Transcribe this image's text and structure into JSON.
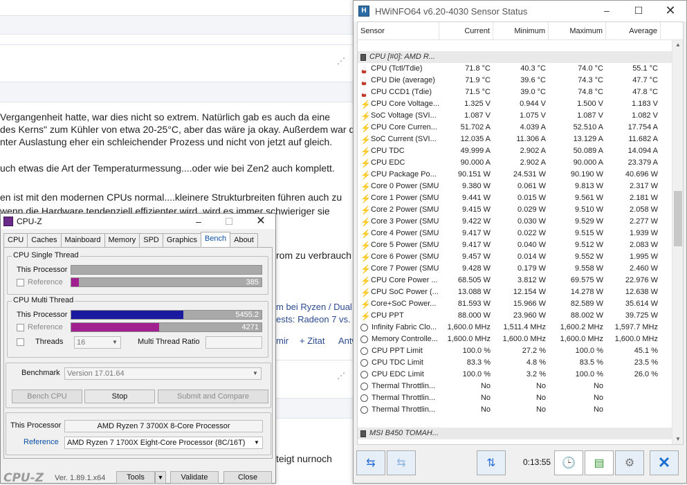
{
  "forum": {
    "top_actions": [
      "Zitat"
    ],
    "p1_line1": "Vergangenheit hatte, war dies nicht so extrem. Natürlich gab es auch da eine",
    "p1_line2": "des Kerns\" zum Kühler von etwa 20-25°C, aber das wäre ja okay. Außerdem war dort de",
    "p1_line3": "nter Auslastung eher ein schleichender Prozess und nicht von jetzt auf gleich.",
    "p2": "uch etwas die Art der Temperaturmessung....oder wie bei Zen2 auch komplett.",
    "p3_line1": "en ist mit den modernen CPUs normal....kleinere Strukturbreiten führen auch zu",
    "p3_line2": "wenn die Hardware tendenziell effizienter wird, wird es immer schwieriger sie",
    "strom": "rom zu verbrauch",
    "link1": "m bei Ryzen / Dual ch",
    "link2": "ests: Radeon 7 vs. Veg",
    "mir": "mir",
    "zitat": "+ Zitat",
    "antw": "Antw",
    "steigt": "teigt nurnoch"
  },
  "hwinfo": {
    "title": "HWiNFO64 v6.20-4030 Sensor Status",
    "columns": [
      "Sensor",
      "Current",
      "Minimum",
      "Maximum",
      "Average"
    ],
    "groups": [
      {
        "name": "CPU [#0]: AMD R...",
        "rows": [
          {
            "icon": "thermometer-icon",
            "name": "CPU (Tctl/Tdie)",
            "cur": "71.8 °C",
            "min": "40.3 °C",
            "max": "74.0 °C",
            "avg": "55.1 °C"
          },
          {
            "icon": "thermometer-icon",
            "name": "CPU Die (average)",
            "cur": "71.9 °C",
            "min": "39.6 °C",
            "max": "74.3 °C",
            "avg": "47.7 °C"
          },
          {
            "icon": "thermometer-icon",
            "name": "CPU CCD1 (Tdie)",
            "cur": "71.5 °C",
            "min": "39.0 °C",
            "max": "74.8 °C",
            "avg": "47.8 °C"
          },
          {
            "icon": "bolt-icon",
            "name": "CPU Core Voltage...",
            "cur": "1.325 V",
            "min": "0.944 V",
            "max": "1.500 V",
            "avg": "1.183 V"
          },
          {
            "icon": "bolt-icon",
            "name": "SoC Voltage (SVI...",
            "cur": "1.087 V",
            "min": "1.075 V",
            "max": "1.087 V",
            "avg": "1.082 V"
          },
          {
            "icon": "bolt-icon",
            "name": "CPU Core Curren...",
            "cur": "51.702 A",
            "min": "4.039 A",
            "max": "52.510 A",
            "avg": "17.754 A"
          },
          {
            "icon": "bolt-icon",
            "name": "SoC Current (SVI...",
            "cur": "12.035 A",
            "min": "11.306 A",
            "max": "13.129 A",
            "avg": "11.682 A"
          },
          {
            "icon": "bolt-icon",
            "name": "CPU TDC",
            "cur": "49.999 A",
            "min": "2.902 A",
            "max": "50.089 A",
            "avg": "14.094 A"
          },
          {
            "icon": "bolt-icon",
            "name": "CPU EDC",
            "cur": "90.000 A",
            "min": "2.902 A",
            "max": "90.000 A",
            "avg": "23.379 A"
          },
          {
            "icon": "bolt-icon",
            "name": "CPU Package Po...",
            "cur": "90.151 W",
            "min": "24.531 W",
            "max": "90.190 W",
            "avg": "40.696 W"
          },
          {
            "icon": "bolt-icon",
            "name": "Core 0 Power (SMU)",
            "cur": "9.380 W",
            "min": "0.061 W",
            "max": "9.813 W",
            "avg": "2.317 W"
          },
          {
            "icon": "bolt-icon",
            "name": "Core 1 Power (SMU)",
            "cur": "9.441 W",
            "min": "0.015 W",
            "max": "9.561 W",
            "avg": "2.181 W"
          },
          {
            "icon": "bolt-icon",
            "name": "Core 2 Power (SMU)",
            "cur": "9.415 W",
            "min": "0.029 W",
            "max": "9.510 W",
            "avg": "2.058 W"
          },
          {
            "icon": "bolt-icon",
            "name": "Core 3 Power (SMU)",
            "cur": "9.422 W",
            "min": "0.030 W",
            "max": "9.529 W",
            "avg": "2.277 W"
          },
          {
            "icon": "bolt-icon",
            "name": "Core 4 Power (SMU)",
            "cur": "9.417 W",
            "min": "0.022 W",
            "max": "9.515 W",
            "avg": "1.939 W"
          },
          {
            "icon": "bolt-icon",
            "name": "Core 5 Power (SMU)",
            "cur": "9.417 W",
            "min": "0.040 W",
            "max": "9.512 W",
            "avg": "2.083 W"
          },
          {
            "icon": "bolt-icon",
            "name": "Core 6 Power (SMU)",
            "cur": "9.457 W",
            "min": "0.014 W",
            "max": "9.552 W",
            "avg": "1.995 W"
          },
          {
            "icon": "bolt-icon",
            "name": "Core 7 Power (SMU)",
            "cur": "9.428 W",
            "min": "0.179 W",
            "max": "9.558 W",
            "avg": "2.460 W"
          },
          {
            "icon": "bolt-icon",
            "name": "CPU Core Power ...",
            "cur": "68.505 W",
            "min": "3.812 W",
            "max": "69.575 W",
            "avg": "22.976 W"
          },
          {
            "icon": "bolt-icon",
            "name": "CPU SoC Power (...",
            "cur": "13.088 W",
            "min": "12.154 W",
            "max": "14.278 W",
            "avg": "12.638 W"
          },
          {
            "icon": "bolt-icon",
            "name": "Core+SoC Power...",
            "cur": "81.593 W",
            "min": "15.966 W",
            "max": "82.589 W",
            "avg": "35.614 W"
          },
          {
            "icon": "bolt-icon",
            "name": "CPU PPT",
            "cur": "88.000 W",
            "min": "23.960 W",
            "max": "88.002 W",
            "avg": "39.725 W"
          },
          {
            "icon": "clock-icon",
            "name": "Infinity Fabric Clo...",
            "cur": "1,600.0 MHz",
            "min": "1,511.4 MHz",
            "max": "1,600.2 MHz",
            "avg": "1,597.7 MHz"
          },
          {
            "icon": "clock-icon",
            "name": "Memory Controlle...",
            "cur": "1,600.0 MHz",
            "min": "1,600.0 MHz",
            "max": "1,600.0 MHz",
            "avg": "1,600.0 MHz"
          },
          {
            "icon": "clock-icon",
            "name": "CPU PPT Limit",
            "cur": "100.0 %",
            "min": "27.2 %",
            "max": "100.0 %",
            "avg": "45.1 %"
          },
          {
            "icon": "clock-icon",
            "name": "CPU TDC Limit",
            "cur": "83.3 %",
            "min": "4.8 %",
            "max": "83.5 %",
            "avg": "23.5 %"
          },
          {
            "icon": "clock-icon",
            "name": "CPU EDC Limit",
            "cur": "100.0 %",
            "min": "3.2 %",
            "max": "100.0 %",
            "avg": "26.0 %"
          },
          {
            "icon": "clock-icon",
            "name": "Thermal Throttlin...",
            "cur": "No",
            "min": "No",
            "max": "No",
            "avg": ""
          },
          {
            "icon": "clock-icon",
            "name": "Thermal Throttlin...",
            "cur": "No",
            "min": "No",
            "max": "No",
            "avg": ""
          },
          {
            "icon": "clock-icon",
            "name": "Thermal Throttlin...",
            "cur": "No",
            "min": "No",
            "max": "No",
            "avg": ""
          }
        ]
      },
      {
        "name": "MSI B450 TOMAH...",
        "rows": []
      }
    ],
    "timer": "0:13:55"
  },
  "cpuz": {
    "title": "CPU-Z",
    "tabs": [
      "CPU",
      "Caches",
      "Mainboard",
      "Memory",
      "SPD",
      "Graphics",
      "Bench",
      "About"
    ],
    "active_tab": "Bench",
    "single_thread": {
      "label": "CPU Single Thread",
      "this_label": "This Processor",
      "this_value": "",
      "ref_label": "Reference",
      "ref_value": "385",
      "ref_fraction": 0.039
    },
    "multi_thread": {
      "label": "CPU Multi Thread",
      "this_label": "This Processor",
      "this_value": "5455.2",
      "this_fraction": 0.59,
      "ref_label": "Reference",
      "ref_value": "4271",
      "ref_fraction": 0.462,
      "threads_label": "Threads",
      "threads_value": "16",
      "ratio_label": "Multi Thread Ratio"
    },
    "benchmark_label": "Benchmark",
    "benchmark_version": "Version 17.01.64",
    "bench_cpu": "Bench CPU",
    "stop": "Stop",
    "submit": "Submit and Compare",
    "this_processor_label": "This Processor",
    "this_processor": "AMD Ryzen 7 3700X 8-Core Processor",
    "reference_label": "Reference",
    "reference": "AMD Ryzen 7 1700X Eight-Core Processor (8C/16T)",
    "footer_logo": "CPU-Z",
    "footer_ver": "Ver. 1.89.1.x64",
    "tools": "Tools",
    "validate": "Validate",
    "close": "Close",
    "colors": {
      "blue_bar": "#1a1aa0",
      "purple_bar": "#a0208f"
    }
  }
}
